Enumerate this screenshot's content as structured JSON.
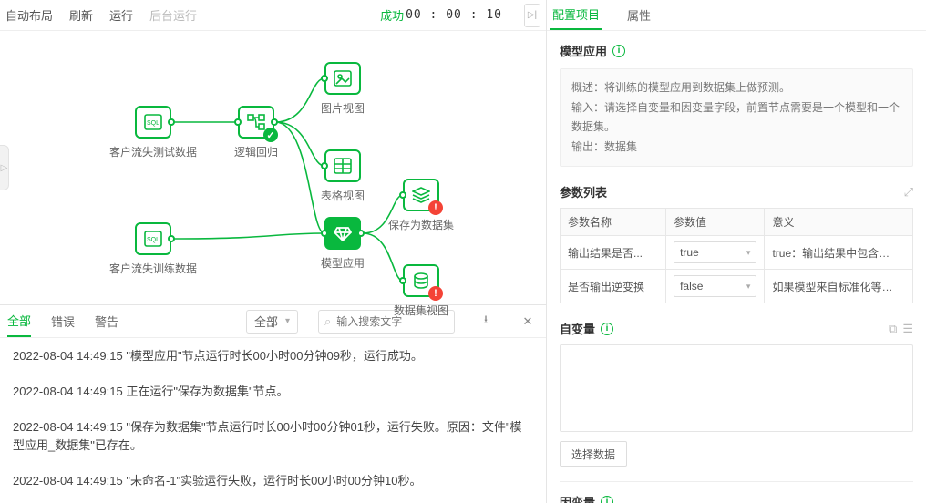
{
  "toolbar": {
    "auto_layout": "自动布局",
    "refresh": "刷新",
    "run": "运行",
    "bg_run": "后台运行"
  },
  "status": {
    "label": "成功",
    "time": "00 : 00 : 10"
  },
  "nodes": {
    "test_data": "客户流失测试数据",
    "logic": "逻辑回归",
    "img_view": "图片视图",
    "table_view": "表格视图",
    "train_data": "客户流失训练数据",
    "model_apply": "模型应用",
    "save_ds": "保存为数据集",
    "ds_view": "数据集视图"
  },
  "logtabs": {
    "all": "全部",
    "error": "错误",
    "warn": "警告"
  },
  "filter": "全部",
  "search_ph": "输入搜索文字",
  "logs": [
    "2022-08-04 14:49:15 \"模型应用\"节点运行时长00小时00分钟09秒，运行成功。",
    "2022-08-04 14:49:15 正在运行\"保存为数据集\"节点。",
    "2022-08-04 14:49:15 \"保存为数据集\"节点运行时长00小时00分钟01秒，运行失败。原因：文件\"模型应用_数据集\"已存在。",
    "2022-08-04 14:49:15 \"未命名-1\"实验运行失败，运行时长00小时00分钟10秒。"
  ],
  "rtabs": {
    "config": "配置项目",
    "attr": "属性"
  },
  "model": {
    "title": "模型应用",
    "desc": "概述：将训练的模型应用到数据集上做预测。",
    "input": "输入：请选择自变量和因变量字段，前置节点需要是一个模型和一个数据集。",
    "output": "输出：数据集"
  },
  "param": {
    "title": "参数列表",
    "h_name": "参数名称",
    "h_val": "参数值",
    "h_mean": "意义",
    "rows": [
      {
        "name": "输出结果是否...",
        "val": "true",
        "mean": "true：输出结果中包含输入数据..."
      },
      {
        "name": "是否输出逆变换",
        "val": "false",
        "mean": "如果模型来自标准化等数据变换..."
      }
    ]
  },
  "ivar": {
    "title": "自变量"
  },
  "select_btn": "选择数据",
  "dvar": {
    "title": "因变量"
  }
}
